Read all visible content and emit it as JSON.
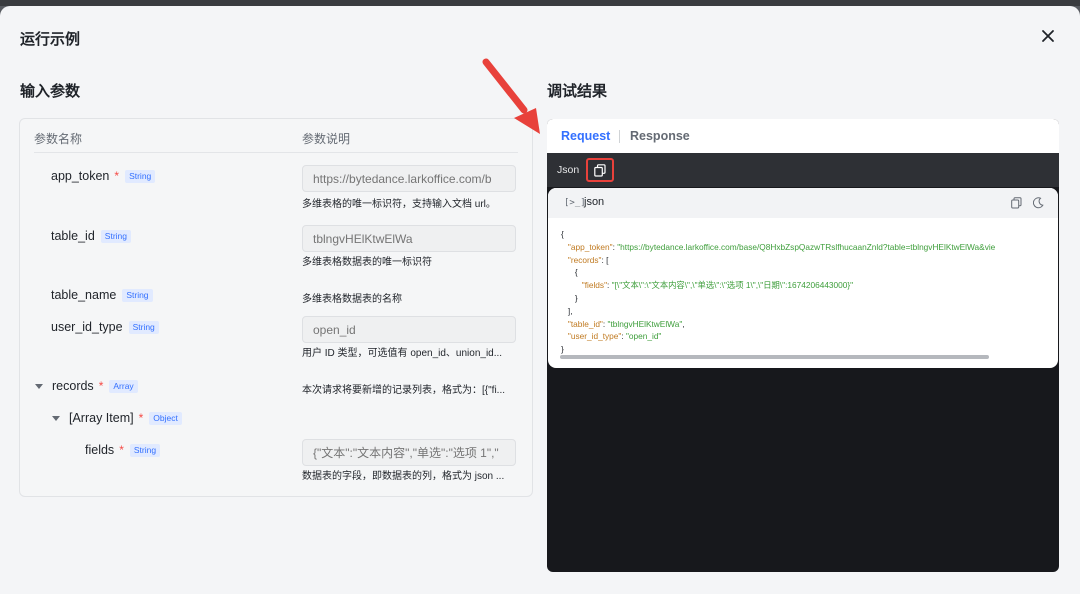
{
  "modal": {
    "title": "运行示例"
  },
  "left": {
    "title": "输入参数",
    "col_name": "参数名称",
    "col_desc": "参数说明",
    "params": [
      {
        "name": "app_token",
        "required": true,
        "type": "String",
        "placeholder": "https://bytedance.larkoffice.com/b",
        "desc": "多维表格的唯一标识符，支持输入文档 url。"
      },
      {
        "name": "table_id",
        "required": false,
        "type": "String",
        "placeholder": "tblngvHElKtwElWa",
        "desc": "多维表格数据表的唯一标识符"
      },
      {
        "name": "table_name",
        "required": false,
        "type": "String",
        "desc": "多维表格数据表的名称"
      },
      {
        "name": "user_id_type",
        "required": false,
        "type": "String",
        "placeholder": "open_id",
        "desc": "用户 ID 类型，可选值有 open_id、union_id..."
      },
      {
        "name": "records",
        "required": true,
        "type": "Array",
        "desc": "本次请求将要新增的记录列表，格式为：[{\"fi..."
      },
      {
        "name": "[Array Item]",
        "required": true,
        "type": "Object"
      },
      {
        "name": "fields",
        "required": true,
        "type": "String",
        "placeholder": "{\"文本\":\"文本内容\",\"单选\":\"选项 1\",\"",
        "desc": "数据表的字段，即数据表的列，格式为 json ..."
      }
    ]
  },
  "right": {
    "title": "调试结果",
    "tabs": [
      "Request",
      "Response"
    ],
    "toolbar_label": "Json",
    "code_prompt": "[>_]",
    "code_lang": "json",
    "code": {
      "open": "{",
      "app_token_key": "\"app_token\"",
      "app_token_val": "\"https://bytedance.larkoffice.com/base/Q8HxbZspQazwTRslfhucaanZnld?table=tblngvHElKtwElWa&vie",
      "records_key": "\"records\"",
      "fields_key": "\"fields\"",
      "fields_val": "\"[\\\"文本\\\":\\\"文本内容\\\",\\\"单选\\\":\\\"选项 1\\\",\\\"日期\\\":1674206443000}\"",
      "table_id_key": "\"table_id\"",
      "table_id_val": "\"tblngvHElKtwElWa\"",
      "user_id_type_key": "\"user_id_type\"",
      "user_id_type_val": "\"open_id\"",
      "close": "}"
    }
  },
  "colors": {
    "accent": "#3370ff",
    "highlight": "#e8413b",
    "code_key": "#c07a21",
    "code_string": "#3e9e3b"
  }
}
